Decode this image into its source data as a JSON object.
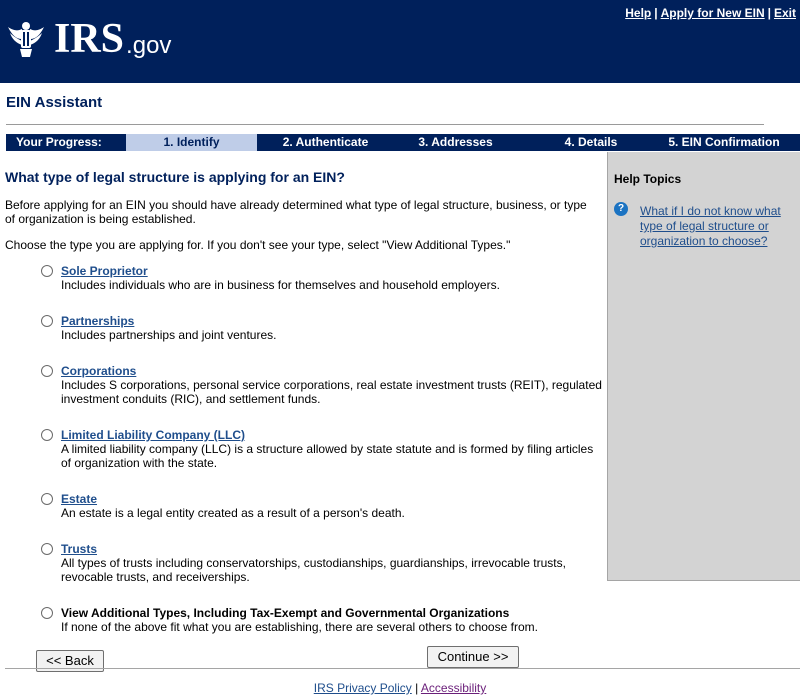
{
  "header": {
    "logo_text": "IRS",
    "logo_suffix": ".gov",
    "links": [
      "Help",
      "Apply for New EIN",
      "Exit"
    ]
  },
  "page_title": "EIN Assistant",
  "progress": {
    "label": "Your Progress:",
    "steps": [
      "1. Identify",
      "2. Authenticate",
      "3. Addresses",
      "4. Details",
      "5. EIN Confirmation"
    ],
    "active_step": "1. Identify"
  },
  "main": {
    "question": "What type of legal structure is applying for an EIN?",
    "intro": "Before applying for an EIN you should have already determined what type of legal structure, business, or type of organization is being established.",
    "choose": "Choose the type you are applying for. If you don't see your type, select \"View Additional Types.\"",
    "options": [
      {
        "title": "Sole Proprietor",
        "desc": "Includes individuals who are in business for themselves and household employers."
      },
      {
        "title": "Partnerships",
        "desc": "Includes partnerships and joint ventures."
      },
      {
        "title": "Corporations",
        "desc": "Includes S corporations, personal service corporations, real estate investment trusts (REIT), regulated investment conduits (RIC), and settlement funds."
      },
      {
        "title": "Limited Liability Company (LLC)",
        "desc": "A limited liability company (LLC) is a structure allowed by state statute and is formed by filing articles of organization with the state."
      },
      {
        "title": "Estate",
        "desc": "An estate is a legal entity created as a result of a person's death."
      },
      {
        "title": "Trusts",
        "desc": "All types of trusts including conservatorships, custodianships, guardianships, irrevocable trusts, revocable trusts, and receiverships."
      },
      {
        "title": "View Additional Types, Including Tax-Exempt and Governmental Organizations",
        "desc": "If none of the above fit what you are establishing, there are several others to choose from."
      }
    ]
  },
  "sidebar": {
    "title": "Help Topics",
    "icon": "question-circle-icon",
    "link": "What if I do not know what type of legal structure or organization to choose?"
  },
  "buttons": {
    "back": "<< Back",
    "continue": "Continue >>"
  },
  "footer": {
    "privacy": "IRS Privacy Policy",
    "separator": "|",
    "accessibility": "Accessibility"
  },
  "colors": {
    "navy": "#00205b",
    "active_step": "#bfcde8",
    "sidebar": "#d3d3d3",
    "link": "#1f4e8c"
  }
}
